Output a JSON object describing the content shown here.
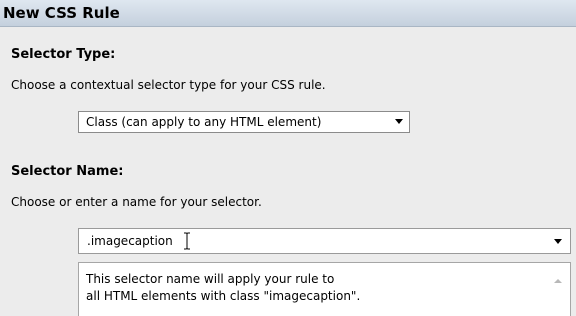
{
  "dialog": {
    "title": "New CSS Rule"
  },
  "selector_type": {
    "heading": "Selector Type:",
    "description": "Choose a contextual selector type for your CSS rule.",
    "selected_value": "Class (can apply to any HTML element)"
  },
  "selector_name": {
    "heading": "Selector Name:",
    "description": "Choose or enter a name for your selector.",
    "value": ".imagecaption",
    "info_line1": "This selector name will apply your rule to",
    "info_line2": "all HTML elements with class \"imagecaption\"."
  }
}
